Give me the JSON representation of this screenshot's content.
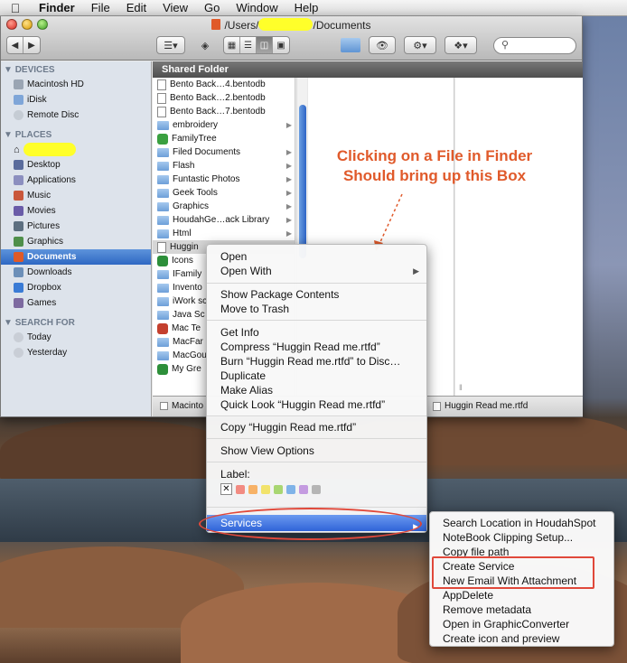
{
  "menubar": {
    "app": "Finder",
    "items": [
      "File",
      "Edit",
      "View",
      "Go",
      "Window",
      "Help"
    ]
  },
  "window": {
    "title_prefix": "/Users/",
    "title_suffix": "/Documents",
    "header": "Shared Folder"
  },
  "sidebar": {
    "devices_head": "DEVICES",
    "devices": [
      "Macintosh HD",
      "iDisk",
      "Remote Disc"
    ],
    "places_head": "PLACES",
    "places": [
      "Desktop",
      "Applications",
      "Music",
      "Movies",
      "Pictures",
      "Graphics",
      "Documents",
      "Downloads",
      "Dropbox",
      "Games"
    ],
    "search_head": "SEARCH FOR",
    "search": [
      "Today",
      "Yesterday"
    ]
  },
  "files": [
    {
      "name": "Bento Back…4.bentodb",
      "kind": "file"
    },
    {
      "name": "Bento Back…2.bentodb",
      "kind": "file"
    },
    {
      "name": "Bento Back…7.bentodb",
      "kind": "file"
    },
    {
      "name": "embroidery",
      "kind": "folder"
    },
    {
      "name": "FamilyTree",
      "kind": "app"
    },
    {
      "name": "Filed Documents",
      "kind": "folder"
    },
    {
      "name": "Flash",
      "kind": "folder"
    },
    {
      "name": "Funtastic Photos",
      "kind": "folder"
    },
    {
      "name": "Geek Tools",
      "kind": "folder"
    },
    {
      "name": "Graphics",
      "kind": "folder"
    },
    {
      "name": "HoudahGe…ack Library",
      "kind": "folder"
    },
    {
      "name": "Html",
      "kind": "folder"
    },
    {
      "name": "Huggin",
      "kind": "file"
    },
    {
      "name": "Icons",
      "kind": "app"
    },
    {
      "name": "IFamily",
      "kind": "folder"
    },
    {
      "name": "Invento",
      "kind": "folder"
    },
    {
      "name": "iWork sc",
      "kind": "folder"
    },
    {
      "name": "Java Sc",
      "kind": "folder"
    },
    {
      "name": "Mac Te",
      "kind": "app"
    },
    {
      "name": "MacFar",
      "kind": "folder"
    },
    {
      "name": "MacGou",
      "kind": "folder"
    },
    {
      "name": "My Gre",
      "kind": "app"
    }
  ],
  "status": {
    "left": "Macinto",
    "right": "Huggin Read me.rtfd"
  },
  "annotation": "Clicking on a File in Finder Should bring up this Box",
  "context_menu": {
    "open": "Open",
    "open_with": "Open With",
    "show_package": "Show Package Contents",
    "move_trash": "Move to Trash",
    "get_info": "Get Info",
    "compress": "Compress “Huggin Read me.rtfd”",
    "burn": "Burn “Huggin Read me.rtfd” to Disc…",
    "duplicate": "Duplicate",
    "make_alias": "Make Alias",
    "quick_look": "Quick Look “Huggin Read me.rtfd”",
    "copy": "Copy “Huggin Read me.rtfd”",
    "show_view_options": "Show View Options",
    "label": "Label:",
    "services": "Services",
    "label_colors": [
      "#f28b82",
      "#f7b267",
      "#f2e36b",
      "#a8d672",
      "#7fb3e8",
      "#c49be0",
      "#b5b5b5"
    ]
  },
  "services_menu": [
    "Search Location in HoudahSpot",
    "NoteBook Clipping Setup...",
    "Copy file path",
    "Create Service",
    "New Email With Attachment",
    "AppDelete",
    "Remove metadata",
    "Open in GraphicConverter",
    "Create icon and preview"
  ]
}
